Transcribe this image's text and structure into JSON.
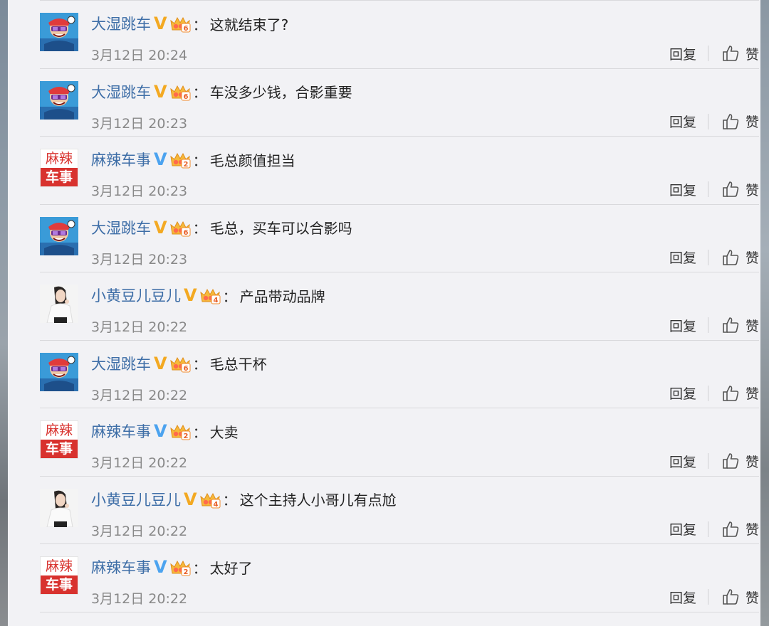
{
  "users": {
    "dashi": {
      "name": "大湿跳车",
      "verified": "V",
      "badge": "gold",
      "level": "6"
    },
    "mala": {
      "name": "麻辣车事",
      "verified": "V",
      "badge": "blue",
      "level": "2"
    },
    "xhd": {
      "name": "小黄豆儿豆儿",
      "verified": "V",
      "badge": "gold",
      "level": "4"
    }
  },
  "avatar_text": {
    "mala_top": "麻辣",
    "mala_bottom": "车事"
  },
  "labels": {
    "reply": "回复",
    "like": "赞",
    "colon": "："
  },
  "comments": [
    {
      "user": "dashi",
      "name": "大湿跳车",
      "text": "这就结束了?",
      "time": "3月12日 20:24"
    },
    {
      "user": "dashi",
      "name": "大湿跳车",
      "text": "车没多少钱，合影重要",
      "time": "3月12日 20:23"
    },
    {
      "user": "mala",
      "name": "麻辣车事",
      "text": "毛总颜值担当",
      "time": "3月12日 20:23"
    },
    {
      "user": "dashi",
      "name": "大湿跳车",
      "text": "毛总，买车可以合影吗",
      "time": "3月12日 20:23"
    },
    {
      "user": "xhd",
      "name": "小黄豆儿豆儿",
      "text": "产品带动品牌",
      "time": "3月12日 20:22"
    },
    {
      "user": "dashi",
      "name": "大湿跳车",
      "text": "毛总干杯",
      "time": "3月12日 20:22"
    },
    {
      "user": "mala",
      "name": "麻辣车事",
      "text": "大卖",
      "time": "3月12日 20:22"
    },
    {
      "user": "xhd",
      "name": "小黄豆儿豆儿",
      "text": "这个主持人小哥儿有点尬",
      "time": "3月12日 20:22"
    },
    {
      "user": "mala",
      "name": "麻辣车事",
      "text": "太好了",
      "time": "3月12日 20:22"
    }
  ],
  "colors": {
    "username": "#3e6ea7",
    "gold_v": "#f3a922",
    "blue_v": "#4ca3ef",
    "mala_red": "#d8322e"
  }
}
